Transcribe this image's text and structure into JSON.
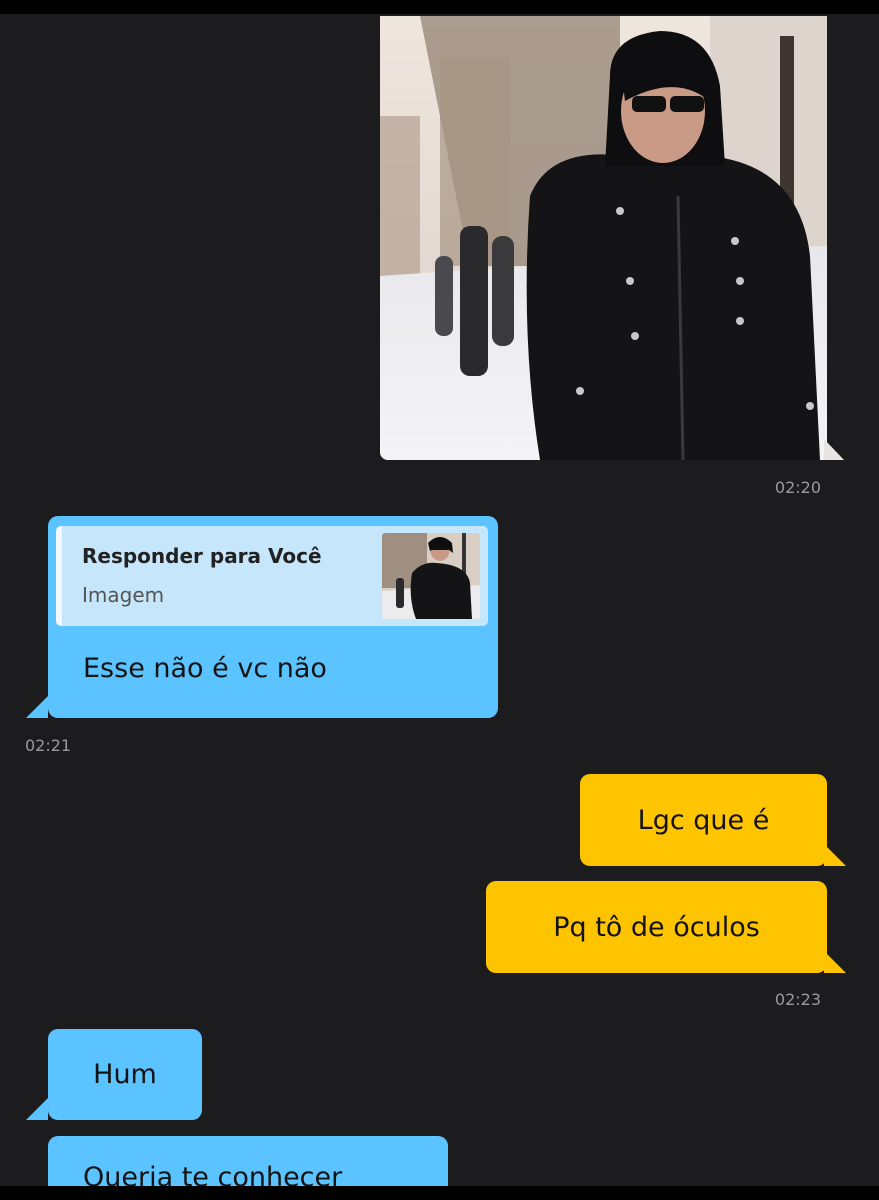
{
  "messages": {
    "sent_image": {
      "description_icon": "photo-thumbnail",
      "timestamp": "02:20"
    },
    "reply": {
      "quote_author": "Responder para Você",
      "quote_type": "Imagem",
      "text": "Esse não é vc não",
      "timestamp": "02:21"
    },
    "out_1": {
      "text": "Lgc que é"
    },
    "out_2": {
      "text": "Pq tô de óculos",
      "timestamp": "02:23"
    },
    "in_1": {
      "text": "Hum"
    },
    "in_2": {
      "text": "Queria te conhecer"
    }
  },
  "colors": {
    "background": "#1c1c1e",
    "incoming_bubble": "#5bc3ff",
    "outgoing_bubble": "#ffc400",
    "quote_box": "#c6e6fb",
    "timestamp": "#9a9a9e"
  }
}
